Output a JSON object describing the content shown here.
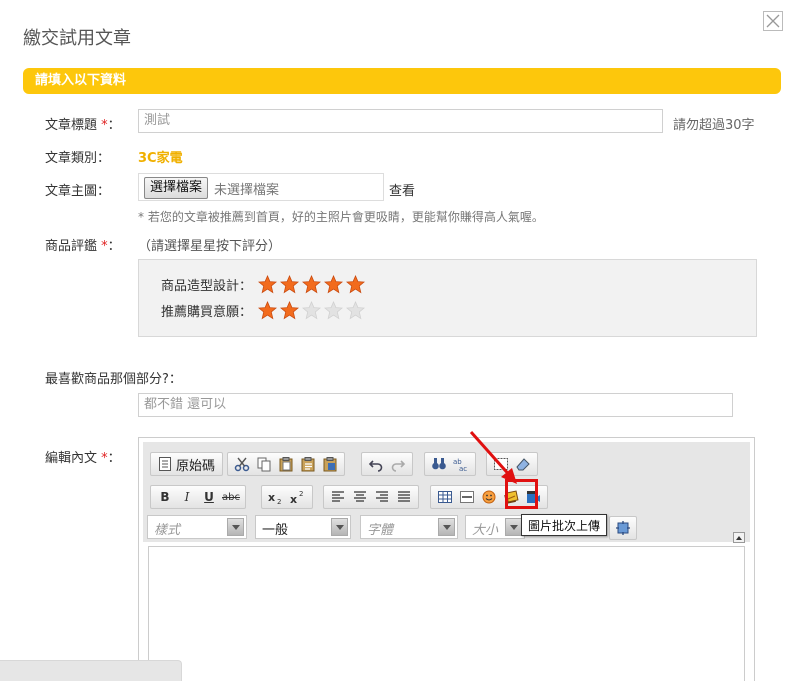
{
  "dialog": {
    "title": "繳交試用文章"
  },
  "section": {
    "title": "請填入以下資料"
  },
  "form": {
    "title_label": "文章標題",
    "title_value": "測試",
    "title_hint": "請勿超過30字",
    "category_label": "文章類別：",
    "category_value": "3C家電",
    "image_label": "文章主圖：",
    "file_button": "選擇檔案",
    "file_status": "未選擇檔案",
    "view_link": "查看",
    "image_note": "* 若您的文章被推薦到首頁，好的主照片會更吸睛，更能幫你賺得高人氣喔。",
    "rating_label": "商品評鑑",
    "rating_note": "（請選擇星星按下評分）",
    "favorite_label": "最喜歡商品那個部分?：",
    "favorite_value": "都不錯 還可以",
    "content_label": "編輯內文",
    "required_mark": "*",
    "colon": "："
  },
  "ratings": [
    {
      "name": "商品造型設計：",
      "score": 5,
      "max": 5
    },
    {
      "name": "推薦購買意願：",
      "score": 2,
      "max": 5
    }
  ],
  "editor": {
    "source_label": "原始碼",
    "styles_combo": "樣式",
    "format_combo": "一般",
    "font_combo": "字體",
    "size_combo": "大小",
    "tooltip": "圖片批次上傳"
  },
  "colors": {
    "accent": "#fdc70c",
    "required": "#e02020",
    "category": "#f0b000",
    "star_on": "#f26b1d",
    "highlight": "#e01010"
  }
}
